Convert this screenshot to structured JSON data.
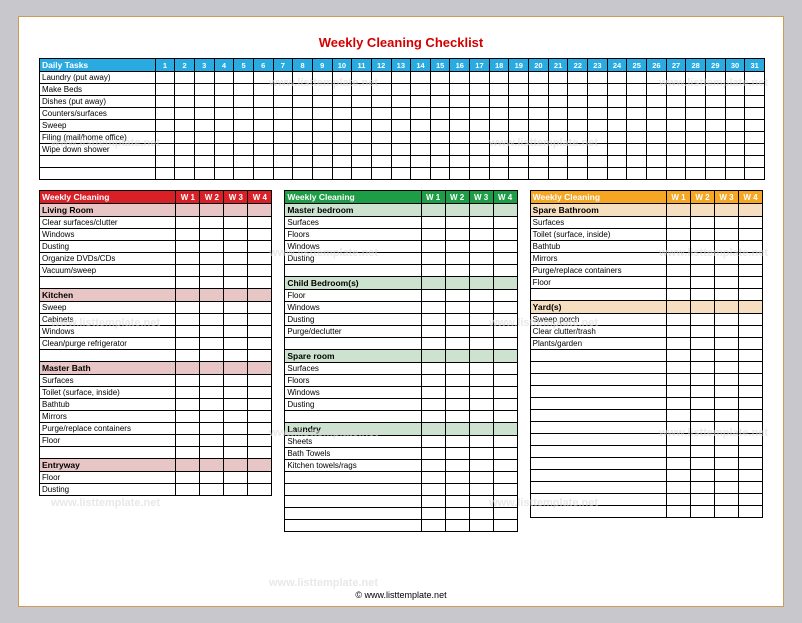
{
  "title": "Weekly Cleaning Checklist",
  "footer": "© www.listtemplate.net",
  "watermark": "www.listtemplate.net",
  "daily": {
    "header": "Daily Tasks",
    "days": [
      "1",
      "2",
      "3",
      "4",
      "5",
      "6",
      "7",
      "8",
      "9",
      "10",
      "11",
      "12",
      "13",
      "14",
      "15",
      "16",
      "17",
      "18",
      "19",
      "20",
      "21",
      "22",
      "23",
      "24",
      "25",
      "26",
      "27",
      "28",
      "29",
      "30",
      "31"
    ],
    "tasks": [
      "Laundry (put away)",
      "Make Beds",
      "Dishes (put away)",
      "Counters/surfaces",
      "Sweep",
      "Filing (mail/home office)",
      "Wipe down shower"
    ],
    "blank_rows": 2
  },
  "columns": [
    {
      "color": "red",
      "header": "Weekly Cleaning",
      "weeks": [
        "W 1",
        "W 2",
        "W 3",
        "W 4"
      ],
      "sections": [
        {
          "title": "Living Room",
          "items": [
            "Clear surfaces/clutter",
            "Windows",
            "Dusting",
            "Organize DVDs/CDs",
            "Vacuum/sweep"
          ]
        },
        {
          "title": "Kitchen",
          "items": [
            "Sweep",
            "Cabinets",
            "Windows",
            "Clean/purge refrigerator"
          ]
        },
        {
          "title": "Master Bath",
          "items": [
            "Surfaces",
            "Toilet (surface, inside)",
            "Bathtub",
            "Mirrors",
            "Purge/replace containers",
            "Floor"
          ]
        },
        {
          "title": "Entryway",
          "items": [
            "Floor",
            "Dusting"
          ]
        }
      ],
      "trailing_blank": 0
    },
    {
      "color": "green",
      "header": "Weekly Cleaning",
      "weeks": [
        "W 1",
        "W 2",
        "W 3",
        "W 4"
      ],
      "sections": [
        {
          "title": "Master bedroom",
          "items": [
            "Surfaces",
            "Floors",
            "Windows",
            "Dusting"
          ]
        },
        {
          "title": "Child Bedroom(s)",
          "items": [
            "Floor",
            "Windows",
            "Dusting",
            "Purge/declutter"
          ]
        },
        {
          "title": "Spare room",
          "items": [
            "Surfaces",
            "Floors",
            "Windows",
            "Dusting"
          ]
        },
        {
          "title": "Laundry",
          "items": [
            "Sheets",
            "Bath Towels",
            "Kitchen towels/rags"
          ]
        }
      ],
      "trailing_blank": 5
    },
    {
      "color": "orange",
      "header": "Weekly Cleaning",
      "weeks": [
        "W 1",
        "W 2",
        "W 3",
        "W 4"
      ],
      "sections": [
        {
          "title": "Spare Bathroom",
          "items": [
            "Surfaces",
            "Toilet (surface, inside)",
            "Bathtub",
            "Mirrors",
            "Purge/replace containers",
            "Floor"
          ]
        },
        {
          "title": "Yard(s)",
          "items": [
            "Sweep porch",
            "Clear clutter/trash",
            "Plants/garden"
          ]
        }
      ],
      "trailing_blank": 14
    }
  ]
}
